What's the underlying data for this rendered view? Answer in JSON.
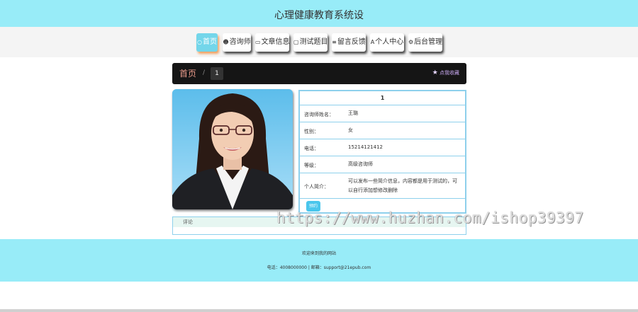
{
  "site": {
    "title": "心理健康教育系统设"
  },
  "nav": {
    "items": [
      {
        "icon": "○",
        "label": "首页",
        "active": true
      },
      {
        "icon": "☻",
        "label": "咨询师"
      },
      {
        "icon": "▭",
        "label": "文章信息"
      },
      {
        "icon": "▢",
        "label": "测试题目"
      },
      {
        "icon": "≡",
        "label": "留言反馈"
      },
      {
        "icon": "A",
        "label": "个人中心"
      },
      {
        "icon": "⚙",
        "label": "后台管理"
      }
    ]
  },
  "breadcrumb": {
    "home": "首页",
    "separator": "/",
    "current": "1",
    "favorite": "点我收藏"
  },
  "detail": {
    "title": "1",
    "rows": [
      {
        "label": "咨询师姓名：",
        "value": "王璐"
      },
      {
        "label": "性别：",
        "value": "女"
      },
      {
        "label": "电话：",
        "value": "15214121412"
      },
      {
        "label": "等级：",
        "value": "高级咨询师"
      },
      {
        "label": "个人简介：",
        "value": "可以发布一些简介信息，内容都是用于测试的，可以自行添加想修改删除"
      }
    ],
    "book_button": "预约"
  },
  "comments": {
    "tab_label": "评论"
  },
  "watermark": "https://www.huzhan.com/ishop39397",
  "footer": {
    "welcome": "欢迎来到我的网站",
    "contact": "电话：4008000000 | 邮箱：support@21epub.com"
  },
  "colors": {
    "header_bg": "#98ecf8",
    "accent": "#73d6ea",
    "border": "#8ed0ec",
    "crumb_bg": "#151515"
  }
}
